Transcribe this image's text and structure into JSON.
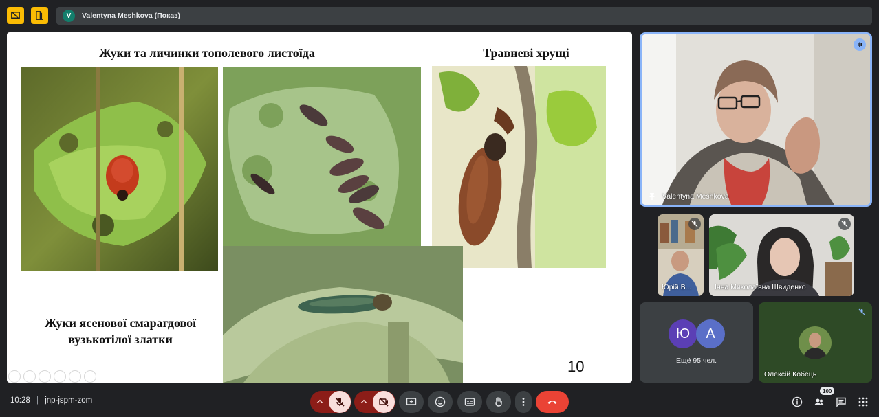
{
  "topbar": {
    "left_icons": [
      "stop-presenting-icon",
      "layout-icon"
    ],
    "presenter_initial": "V",
    "presenter_label": "Valentyna Meshkova (Показ)"
  },
  "slide": {
    "title_left": "Жуки та личинки тополевого листоїда",
    "title_right": "Травневі хрущі",
    "title_bottom_line1": "Жуки ясенової смарагдової",
    "title_bottom_line2": "вузькотілої златки",
    "page_number": "10",
    "photos": [
      "red-leaf-beetle-photo",
      "larvae-on-leaf-photo",
      "may-beetle-photo",
      "emerald-ash-borer-photo"
    ]
  },
  "participants": {
    "main": {
      "name": "Valentyna Meshkova",
      "speaking": true
    },
    "small": [
      {
        "name": "Юрій В...",
        "muted": true
      },
      {
        "name": "Інна Миколаївна Швиденко",
        "muted": true
      }
    ],
    "more": {
      "initials": [
        "Ю",
        "А"
      ],
      "label": "Ещё 95 чел."
    },
    "last": {
      "name": "Олексій Кобець",
      "muted": true
    }
  },
  "bottombar": {
    "time": "10:28",
    "separator": "|",
    "meeting_code": "jnp-jspm-zom",
    "people_count": "100"
  },
  "colors": {
    "background": "#202124",
    "accent_yellow": "#fbbc04",
    "hangup_red": "#ea4335",
    "muted_red": "#8c1d18",
    "muted_pink": "#f9dedc",
    "speaking_blue": "#8ab4f8"
  }
}
